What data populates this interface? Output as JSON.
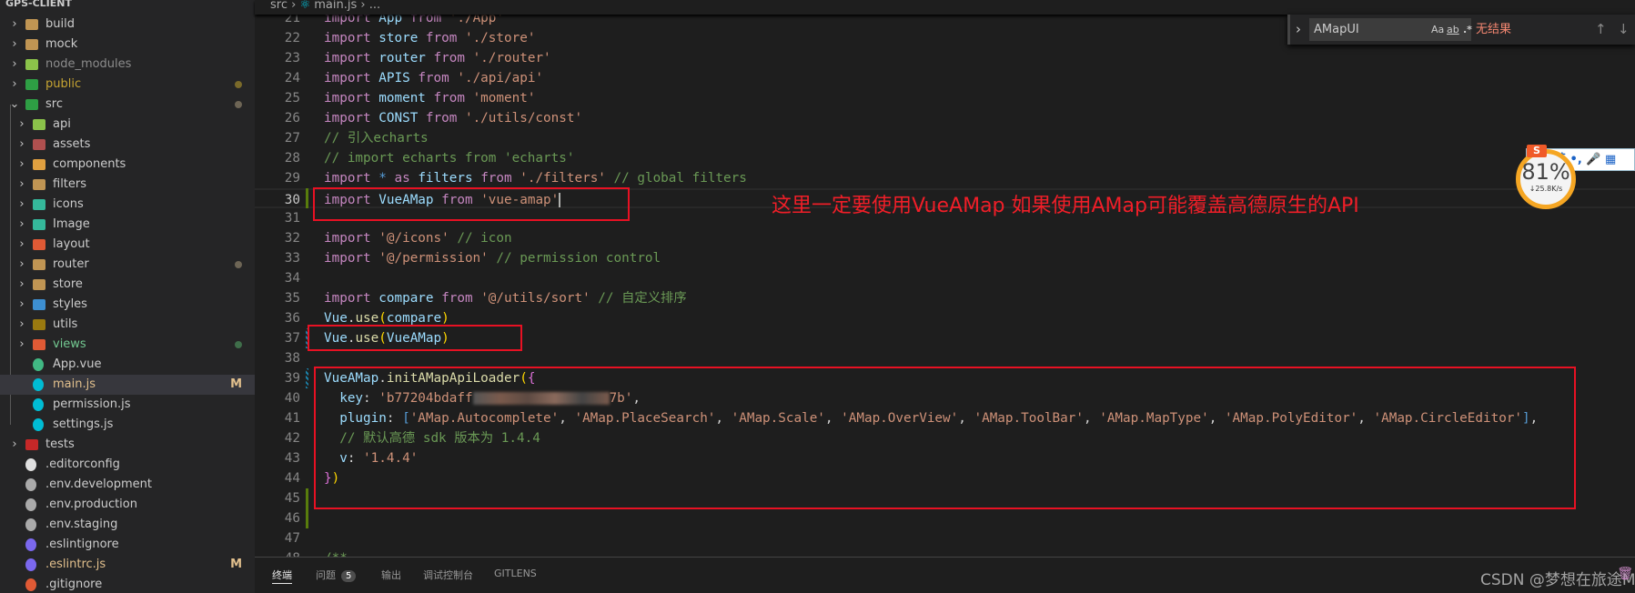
{
  "explorer": {
    "title": "GPS-CLIENT",
    "items": [
      {
        "label": "build",
        "depth": 0,
        "kind": "folder",
        "color": "#c09553",
        "open": false
      },
      {
        "label": "mock",
        "depth": 0,
        "kind": "folder",
        "color": "#c09553",
        "open": false
      },
      {
        "label": "node_modules",
        "depth": 0,
        "kind": "folder",
        "color": "#8bc34a",
        "open": false,
        "dim": true
      },
      {
        "label": "public",
        "depth": 0,
        "kind": "folder",
        "color": "#2e9e44",
        "open": false,
        "textColor": "#c5a332",
        "dot": "#7a6a2a"
      },
      {
        "label": "src",
        "depth": 0,
        "kind": "folder",
        "color": "#2e9e44",
        "open": true,
        "dot": "#6d6555"
      },
      {
        "label": "api",
        "depth": 1,
        "kind": "folder",
        "color": "#8bc34a",
        "open": false
      },
      {
        "label": "assets",
        "depth": 1,
        "kind": "folder",
        "color": "#b0504f",
        "open": false
      },
      {
        "label": "components",
        "depth": 1,
        "kind": "folder",
        "color": "#e0a040",
        "open": false
      },
      {
        "label": "filters",
        "depth": 1,
        "kind": "folder",
        "color": "#c09553",
        "open": false
      },
      {
        "label": "icons",
        "depth": 1,
        "kind": "folder",
        "color": "#35b89b",
        "open": false
      },
      {
        "label": "Image",
        "depth": 1,
        "kind": "folder",
        "color": "#35b89b",
        "open": false
      },
      {
        "label": "layout",
        "depth": 1,
        "kind": "folder",
        "color": "#e05a35",
        "open": false
      },
      {
        "label": "router",
        "depth": 1,
        "kind": "folder",
        "color": "#c09553",
        "open": false,
        "dot": "#6d6555"
      },
      {
        "label": "store",
        "depth": 1,
        "kind": "folder",
        "color": "#c09553",
        "open": false
      },
      {
        "label": "styles",
        "depth": 1,
        "kind": "folder",
        "color": "#3d8fd1",
        "open": false
      },
      {
        "label": "utils",
        "depth": 1,
        "kind": "folder",
        "color": "#9a7a10",
        "open": false
      },
      {
        "label": "views",
        "depth": 1,
        "kind": "folder",
        "color": "#e05a35",
        "open": false,
        "textColor": "#73c991",
        "dot": "#3f6e4a"
      },
      {
        "label": "App.vue",
        "depth": 1,
        "kind": "file",
        "color": "#41b883"
      },
      {
        "label": "main.js",
        "depth": 1,
        "kind": "file",
        "color": "#00bcd4",
        "selected": true,
        "textColor": "#e2c08d",
        "flag": "M"
      },
      {
        "label": "permission.js",
        "depth": 1,
        "kind": "file",
        "color": "#00bcd4"
      },
      {
        "label": "settings.js",
        "depth": 1,
        "kind": "file",
        "color": "#00bcd4"
      },
      {
        "label": "tests",
        "depth": 0,
        "kind": "folder",
        "color": "#c62828",
        "open": false
      },
      {
        "label": ".editorconfig",
        "depth": 0,
        "kind": "file",
        "color": "#e0e0e0"
      },
      {
        "label": ".env.development",
        "depth": 0,
        "kind": "file",
        "color": "#aaaaaa"
      },
      {
        "label": ".env.production",
        "depth": 0,
        "kind": "file",
        "color": "#aaaaaa"
      },
      {
        "label": ".env.staging",
        "depth": 0,
        "kind": "file",
        "color": "#aaaaaa"
      },
      {
        "label": ".eslintignore",
        "depth": 0,
        "kind": "file",
        "color": "#7b68ee"
      },
      {
        "label": ".eslintrc.js",
        "depth": 0,
        "kind": "file",
        "color": "#7b68ee",
        "textColor": "#e2c08d",
        "flag": "M"
      },
      {
        "label": ".gitignore",
        "depth": 0,
        "kind": "file",
        "color": "#e05a35"
      }
    ]
  },
  "breadcrumb": {
    "parts": [
      "src",
      "main.js",
      "..."
    ],
    "sep": "›"
  },
  "editor": {
    "current_line": 30,
    "lines": [
      {
        "n": 21,
        "t": [
          [
            "k",
            "import "
          ],
          [
            "v",
            "App "
          ],
          [
            "k",
            "from "
          ],
          [
            "s",
            "'./App'"
          ]
        ]
      },
      {
        "n": 22,
        "t": [
          [
            "k",
            "import "
          ],
          [
            "v",
            "store "
          ],
          [
            "k",
            "from "
          ],
          [
            "s",
            "'./store'"
          ]
        ]
      },
      {
        "n": 23,
        "t": [
          [
            "k",
            "import "
          ],
          [
            "v",
            "router "
          ],
          [
            "k",
            "from "
          ],
          [
            "s",
            "'./router'"
          ]
        ]
      },
      {
        "n": 24,
        "t": [
          [
            "k",
            "import "
          ],
          [
            "v",
            "APIS "
          ],
          [
            "k",
            "from "
          ],
          [
            "s",
            "'./api/api'"
          ]
        ]
      },
      {
        "n": 25,
        "t": [
          [
            "k",
            "import "
          ],
          [
            "v",
            "moment "
          ],
          [
            "k",
            "from "
          ],
          [
            "s",
            "'moment'"
          ]
        ]
      },
      {
        "n": 26,
        "t": [
          [
            "k",
            "import "
          ],
          [
            "v",
            "CONST "
          ],
          [
            "k",
            "from "
          ],
          [
            "s",
            "'./utils/const'"
          ]
        ]
      },
      {
        "n": 27,
        "t": [
          [
            "c",
            "// 引入echarts"
          ]
        ]
      },
      {
        "n": 28,
        "t": [
          [
            "c",
            "// import echarts from 'echarts'"
          ]
        ]
      },
      {
        "n": 29,
        "t": [
          [
            "k",
            "import "
          ],
          [
            "o",
            "* "
          ],
          [
            "k",
            "as "
          ],
          [
            "v",
            "filters "
          ],
          [
            "k",
            "from "
          ],
          [
            "s",
            "'./filters'"
          ],
          [
            "c",
            " // global filters"
          ]
        ]
      },
      {
        "n": 30,
        "t": [
          [
            "k",
            "import "
          ],
          [
            "v",
            "VueAMap "
          ],
          [
            "k",
            "from "
          ],
          [
            "s",
            "'vue-amap'"
          ]
        ]
      },
      {
        "n": 31,
        "t": []
      },
      {
        "n": 32,
        "t": [
          [
            "k",
            "import "
          ],
          [
            "s",
            "'@/icons'"
          ],
          [
            "c",
            " // icon"
          ]
        ]
      },
      {
        "n": 33,
        "t": [
          [
            "k",
            "import "
          ],
          [
            "s",
            "'@/permission'"
          ],
          [
            "c",
            " // permission control"
          ]
        ]
      },
      {
        "n": 34,
        "t": []
      },
      {
        "n": 35,
        "t": [
          [
            "k",
            "import "
          ],
          [
            "v",
            "compare "
          ],
          [
            "k",
            "from "
          ],
          [
            "s",
            "'@/utils/sort'"
          ],
          [
            "c",
            " // 自定义排序"
          ]
        ]
      },
      {
        "n": 36,
        "t": [
          [
            "v",
            "Vue"
          ],
          [
            "p",
            "."
          ],
          [
            "f",
            "use"
          ],
          [
            "b1",
            "("
          ],
          [
            "v",
            "compare"
          ],
          [
            "b1",
            ")"
          ]
        ]
      },
      {
        "n": 37,
        "t": [
          [
            "v",
            "Vue"
          ],
          [
            "p",
            "."
          ],
          [
            "f",
            "use"
          ],
          [
            "b1",
            "("
          ],
          [
            "v",
            "VueAMap"
          ],
          [
            "b1",
            ")"
          ]
        ]
      },
      {
        "n": 38,
        "t": []
      },
      {
        "n": 39,
        "t": [
          [
            "v",
            "VueAMap"
          ],
          [
            "p",
            "."
          ],
          [
            "f",
            "initAMapApiLoader"
          ],
          [
            "b1",
            "("
          ],
          [
            "b2",
            "{"
          ]
        ]
      },
      {
        "n": 40,
        "t": [
          [
            "p",
            "  "
          ],
          [
            "v",
            "key"
          ],
          [
            "p",
            ": "
          ],
          [
            "s",
            "'b77204bdaff"
          ],
          [
            "blur",
            ""
          ],
          [
            "s",
            "7b'"
          ],
          [
            "p",
            ","
          ]
        ]
      },
      {
        "n": 41,
        "t": [
          [
            "p",
            "  "
          ],
          [
            "v",
            "plugin"
          ],
          [
            "p",
            ": "
          ],
          [
            "o",
            "["
          ],
          [
            "s",
            "'AMap.Autocomplete'"
          ],
          [
            "p",
            ", "
          ],
          [
            "s",
            "'AMap.PlaceSearch'"
          ],
          [
            "p",
            ", "
          ],
          [
            "s",
            "'AMap.Scale'"
          ],
          [
            "p",
            ", "
          ],
          [
            "s",
            "'AMap.OverView'"
          ],
          [
            "p",
            ", "
          ],
          [
            "s",
            "'AMap.ToolBar'"
          ],
          [
            "p",
            ", "
          ],
          [
            "s",
            "'AMap.MapType'"
          ],
          [
            "p",
            ", "
          ],
          [
            "s",
            "'AMap.PolyEditor'"
          ],
          [
            "p",
            ", "
          ],
          [
            "s",
            "'AMap.CircleEditor'"
          ],
          [
            "o",
            "]"
          ],
          [
            "p",
            ","
          ]
        ]
      },
      {
        "n": 42,
        "t": [
          [
            "p",
            "  "
          ],
          [
            "c",
            "// 默认高德 sdk 版本为 1.4.4"
          ]
        ]
      },
      {
        "n": 43,
        "t": [
          [
            "p",
            "  "
          ],
          [
            "v",
            "v"
          ],
          [
            "p",
            ": "
          ],
          [
            "s",
            "'1.4.4'"
          ]
        ]
      },
      {
        "n": 44,
        "t": [
          [
            "b2",
            "}"
          ],
          [
            "b1",
            ")"
          ]
        ]
      },
      {
        "n": 45,
        "t": []
      },
      {
        "n": 46,
        "t": []
      },
      {
        "n": 47,
        "t": []
      },
      {
        "n": 48,
        "t": [
          [
            "c",
            "/**"
          ]
        ]
      }
    ]
  },
  "annotation": "这里一定要使用VueAMap  如果使用AMap可能覆盖高德原生的API",
  "find": {
    "value": "AMapUI",
    "match_case": "Aa",
    "whole_word": "ab",
    "regex": ".*",
    "result": "无结果",
    "prev": "↑",
    "next": "↓",
    "menu": "≡",
    "toggle": "›"
  },
  "panel": {
    "tabs": [
      {
        "label": "终端",
        "active": true
      },
      {
        "label": "问题",
        "badge": "5"
      },
      {
        "label": "输出"
      },
      {
        "label": "调试控制台"
      },
      {
        "label": "GITLENS"
      }
    ]
  },
  "watermark": "CSDN @梦想在旅途Mr_Shaw",
  "overlay": {
    "ime": "英  •,  🎤  ▦",
    "logo": "S",
    "percent": "81%",
    "rate": "↓25.8K/s"
  },
  "colors": {
    "annotation": "#f01e28",
    "box": "#e81123",
    "git_added": "#587c0c",
    "git_modified": "#1b81a8"
  }
}
